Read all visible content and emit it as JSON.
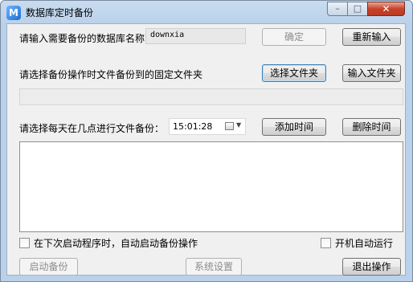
{
  "window": {
    "title": "数据库定时备份",
    "app_icon_glyph": "M",
    "close_glyph": "✕",
    "minimize_glyph": "–",
    "maximize_glyph": "□"
  },
  "db": {
    "label": "请输入需要备份的数据库名称",
    "value": "downxia",
    "confirm_label": "确定",
    "reinput_label": "重新输入"
  },
  "folder": {
    "label": "请选择备份操作时文件备份到的固定文件夹",
    "choose_label": "选择文件夹",
    "input_label": "输入文件夹",
    "path": ""
  },
  "schedule": {
    "label": "请选择每天在几点进行文件备份：",
    "time": "15:01:28",
    "add_label": "添加时间",
    "delete_label": "删除时间",
    "times": []
  },
  "options": {
    "auto_backup_label": "在下次启动程序时，自动启动备份操作",
    "auto_backup_checked": false,
    "autostart_label": "开机自动运行",
    "autostart_checked": false
  },
  "footer": {
    "start_label": "启动备份",
    "settings_label": "系统设置",
    "exit_label": "退出操作"
  },
  "colors": {
    "titlebar": "#c9dcf0",
    "client": "#f0f0f0",
    "close_button": "#c7432b"
  }
}
